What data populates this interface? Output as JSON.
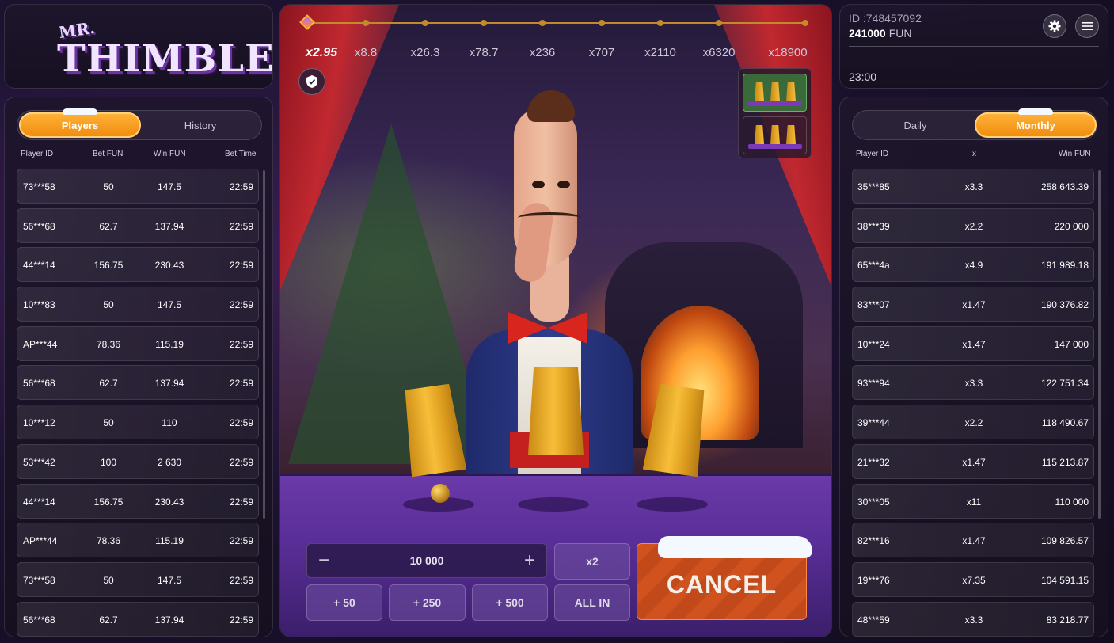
{
  "logo": {
    "prefix": "MR.",
    "name": "THIMBLE"
  },
  "players": {
    "tabs": [
      "Players",
      "History"
    ],
    "active_tab": 0,
    "columns": [
      "Player ID",
      "Bet  FUN",
      "Win  FUN",
      "Bet Time"
    ],
    "rows": [
      [
        "73***58",
        "50",
        "147.5",
        "22:59"
      ],
      [
        "56***68",
        "62.7",
        "137.94",
        "22:59"
      ],
      [
        "44***14",
        "156.75",
        "230.43",
        "22:59"
      ],
      [
        "10***83",
        "50",
        "147.5",
        "22:59"
      ],
      [
        "AP***44",
        "78.36",
        "115.19",
        "22:59"
      ],
      [
        "56***68",
        "62.7",
        "137.94",
        "22:59"
      ],
      [
        "10***12",
        "50",
        "110",
        "22:59"
      ],
      [
        "53***42",
        "100",
        "2 630",
        "22:59"
      ],
      [
        "44***14",
        "156.75",
        "230.43",
        "22:59"
      ],
      [
        "AP***44",
        "78.36",
        "115.19",
        "22:59"
      ],
      [
        "73***58",
        "50",
        "147.5",
        "22:59"
      ],
      [
        "56***68",
        "62.7",
        "137.94",
        "22:59"
      ]
    ]
  },
  "game": {
    "multipliers": [
      "x2.95",
      "x8.8",
      "x26.3",
      "x78.7",
      "x236",
      "x707",
      "x2110",
      "x6320",
      "x18900"
    ],
    "current_index": 0,
    "bet_amount": "10 000",
    "minus": "−",
    "plus": "+",
    "buttons": {
      "double": "x2",
      "add50": "+ 50",
      "add250": "+ 250",
      "add500": "+ 500",
      "allin": "ALL IN",
      "cancel": "CANCEL"
    },
    "cup_modes_active": 0
  },
  "account": {
    "id": "ID :748457092",
    "balance": "241000",
    "currency": "FUN",
    "time": "23:00",
    "settings_icon": "gear-icon",
    "menu_icon": "hamburger-icon"
  },
  "leaderboard": {
    "tabs": [
      "Daily",
      "Monthly"
    ],
    "active_tab": 1,
    "columns": [
      "Player ID",
      "x",
      "Win  FUN"
    ],
    "rows": [
      [
        "35***85",
        "x3.3",
        "258 643.39"
      ],
      [
        "38***39",
        "x2.2",
        "220 000"
      ],
      [
        "65***4a",
        "x4.9",
        "191 989.18"
      ],
      [
        "83***07",
        "x1.47",
        "190 376.82"
      ],
      [
        "10***24",
        "x1.47",
        "147 000"
      ],
      [
        "93***94",
        "x3.3",
        "122 751.34"
      ],
      [
        "39***44",
        "x2.2",
        "118 490.67"
      ],
      [
        "21***32",
        "x1.47",
        "115 213.87"
      ],
      [
        "30***05",
        "x11",
        "110 000"
      ],
      [
        "82***16",
        "x1.47",
        "109 826.57"
      ],
      [
        "19***76",
        "x7.35",
        "104 591.15"
      ],
      [
        "48***59",
        "x3.3",
        "83 218.77"
      ]
    ]
  }
}
